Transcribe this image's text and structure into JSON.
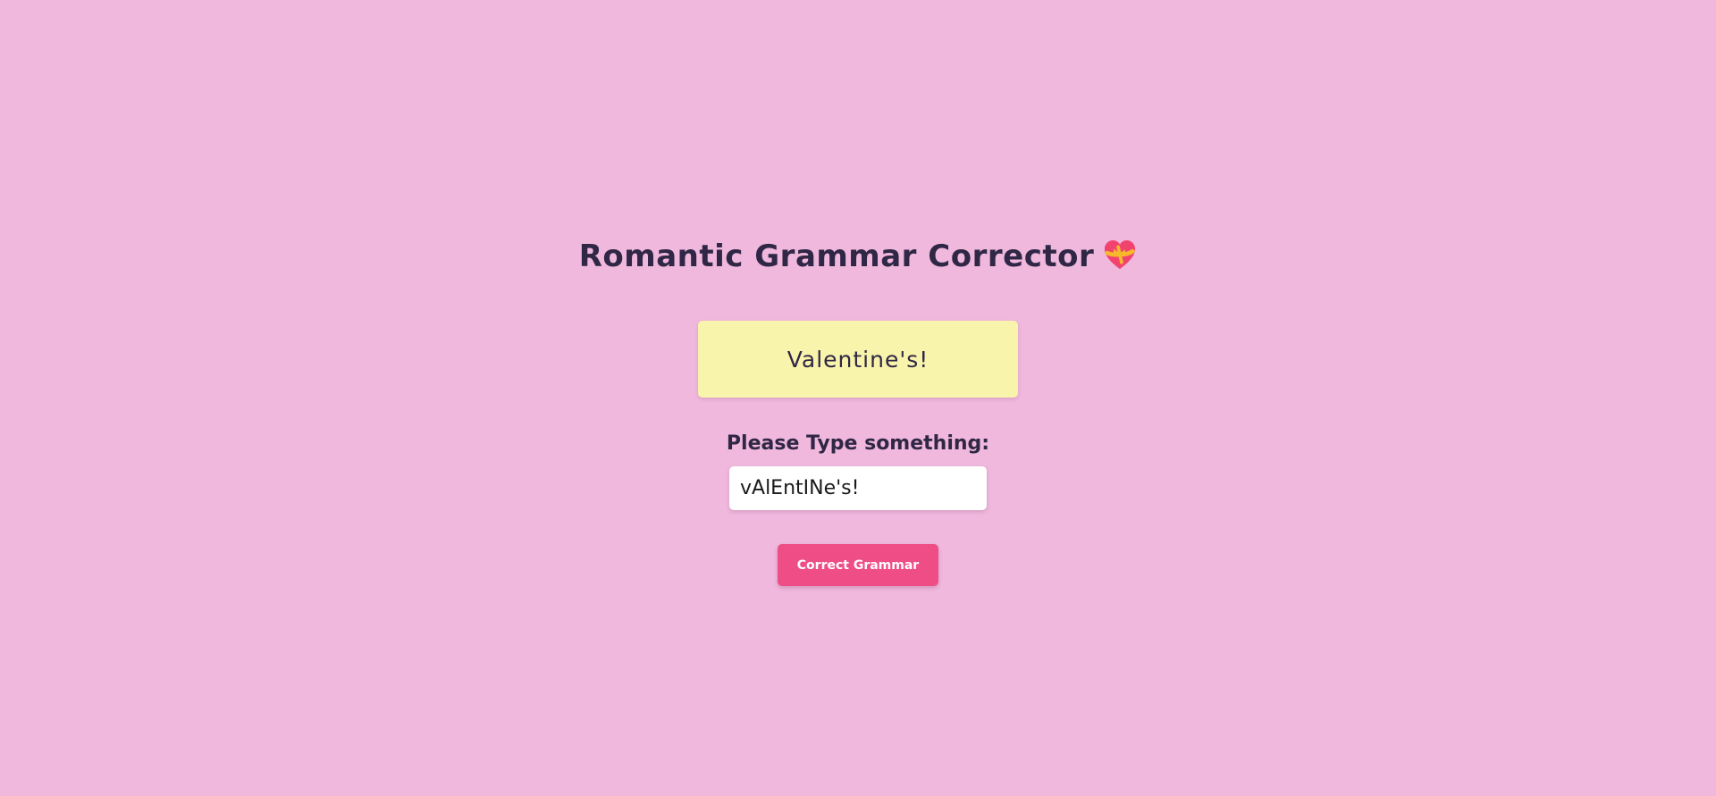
{
  "header": {
    "title": "Romantic Grammar Corrector",
    "icon": "heart-with-ribbon-icon"
  },
  "output": {
    "text": "Valentine's!"
  },
  "form": {
    "label": "Please Type something:",
    "input_value": "vAlEntINe's!",
    "submit_label": "Correct Grammar"
  },
  "colors": {
    "background": "#f0b8dd",
    "output_box": "#f9f4ab",
    "button": "#ee4d86",
    "text": "#2f2745"
  }
}
